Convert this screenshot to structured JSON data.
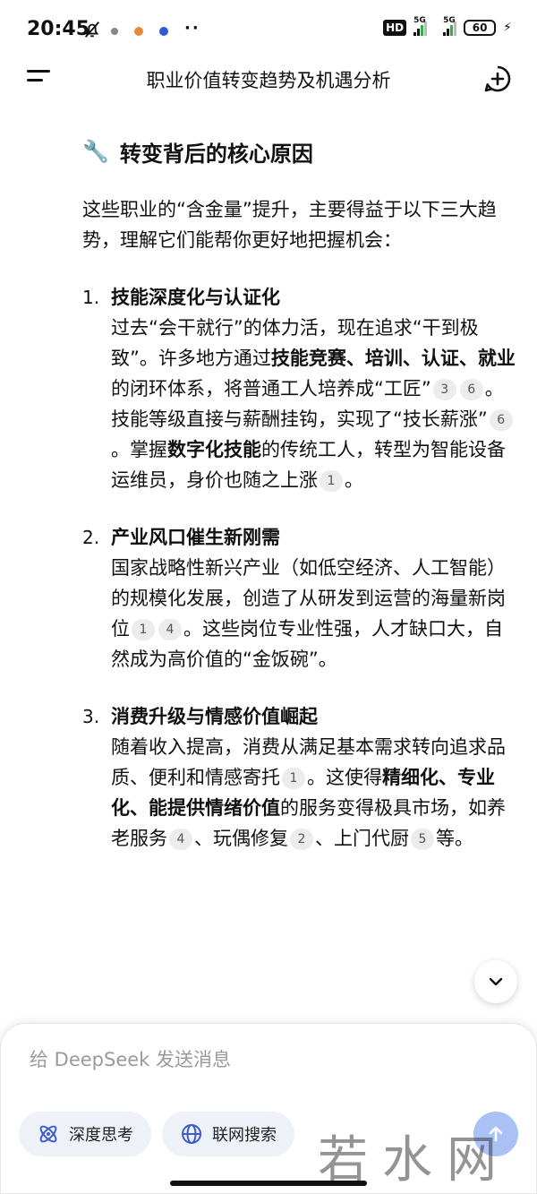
{
  "status_bar": {
    "time": "20:45",
    "hd_label": "HD",
    "signal1_label": "5G",
    "signal2_label": "5G",
    "battery": "60",
    "mute_icon": "bell-off-icon",
    "bolt_icon": "charging-icon"
  },
  "header": {
    "title": "职业价值转变趋势及机遇分析",
    "menu_icon": "menu-icon",
    "new_chat_icon": "plus-circle-icon"
  },
  "section": {
    "icon": "🔧",
    "title": "转变背后的核心原因"
  },
  "intro": "这些职业的“含金量”提升，主要得益于以下三大趋势，理解它们能帮你更好地把握机会：",
  "items": [
    {
      "number": "1.",
      "title": "技能深度化与认证化",
      "body": {
        "t1": "过去“会干就行”的体力活，现在追求“干到极致”。许多地方通过",
        "b1": "技能竞赛、培训、认证、就业",
        "t2": "的闭环体系，将普通工人培养成“工匠”",
        "c1": "3",
        "c2": "6",
        "t3": "。技能等级直接与薪酬挂钩，实现了“技长薪涨”",
        "c3": "6",
        "t4": "。掌握",
        "b2": "数字化技能",
        "t5": "的传统工人，转型为智能设备运维员，身价也随之上涨",
        "c4": "1",
        "t6": "。"
      }
    },
    {
      "number": "2.",
      "title": "产业风口催生新刚需",
      "body": {
        "t1": "国家战略性新兴产业（如低空经济、人工智能）的规模化发展，创造了从研发到运营的海量新岗位",
        "c1": "1",
        "c2": "4",
        "t2": "。这些岗位专业性强，人才缺口大，自然成为高价值的“金饭碗”。"
      }
    },
    {
      "number": "3.",
      "title": "消费升级与情感价值崛起",
      "body": {
        "t1": "随着收入提高，消费从满足基本需求转向追求品质、便利和情感寄托",
        "c1": "1",
        "t2": "。这使得",
        "b1": "精细化、专业化、能提供情绪价值",
        "t3": "的服务变得极具市场，如养老服务",
        "c2": "4",
        "t4": "、玩偶修复",
        "c3": "2",
        "t5": "、上门代厨",
        "c4": "5",
        "t6": "等。"
      }
    }
  ],
  "composer": {
    "placeholder": "给 DeepSeek 发送消息",
    "deep_think_label": "深度思考",
    "web_search_label": "联网搜索"
  },
  "watermark": "若水网",
  "colors": {
    "chip_bg": "#eef1f7",
    "send_button": "#a9c1f5",
    "accent": "#4d6bfe"
  }
}
